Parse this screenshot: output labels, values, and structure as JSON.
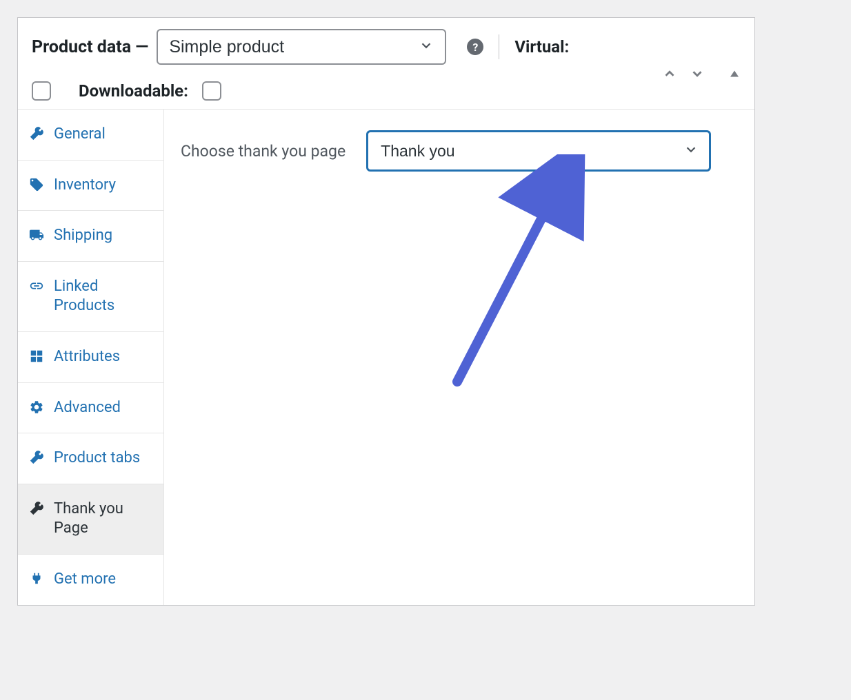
{
  "header": {
    "title": "Product data —",
    "product_type": "Simple product",
    "virtual_label": "Virtual:",
    "downloadable_label": "Downloadable:"
  },
  "sidebar": {
    "items": [
      {
        "label": "General",
        "icon": "wrench"
      },
      {
        "label": "Inventory",
        "icon": "tag"
      },
      {
        "label": "Shipping",
        "icon": "truck"
      },
      {
        "label": "Linked Products",
        "icon": "link"
      },
      {
        "label": "Attributes",
        "icon": "grid"
      },
      {
        "label": "Advanced",
        "icon": "gear"
      },
      {
        "label": "Product tabs",
        "icon": "wrench"
      },
      {
        "label": "Thank you Page",
        "icon": "wrench",
        "active": true
      },
      {
        "label": "Get more",
        "icon": "plug"
      }
    ]
  },
  "content": {
    "field_label": "Choose thank you page",
    "page_select_value": "Thank you"
  },
  "colors": {
    "link": "#2271b1",
    "border": "#c3c4c7",
    "active_bg": "#eee",
    "arrow": "#4f62d4"
  }
}
